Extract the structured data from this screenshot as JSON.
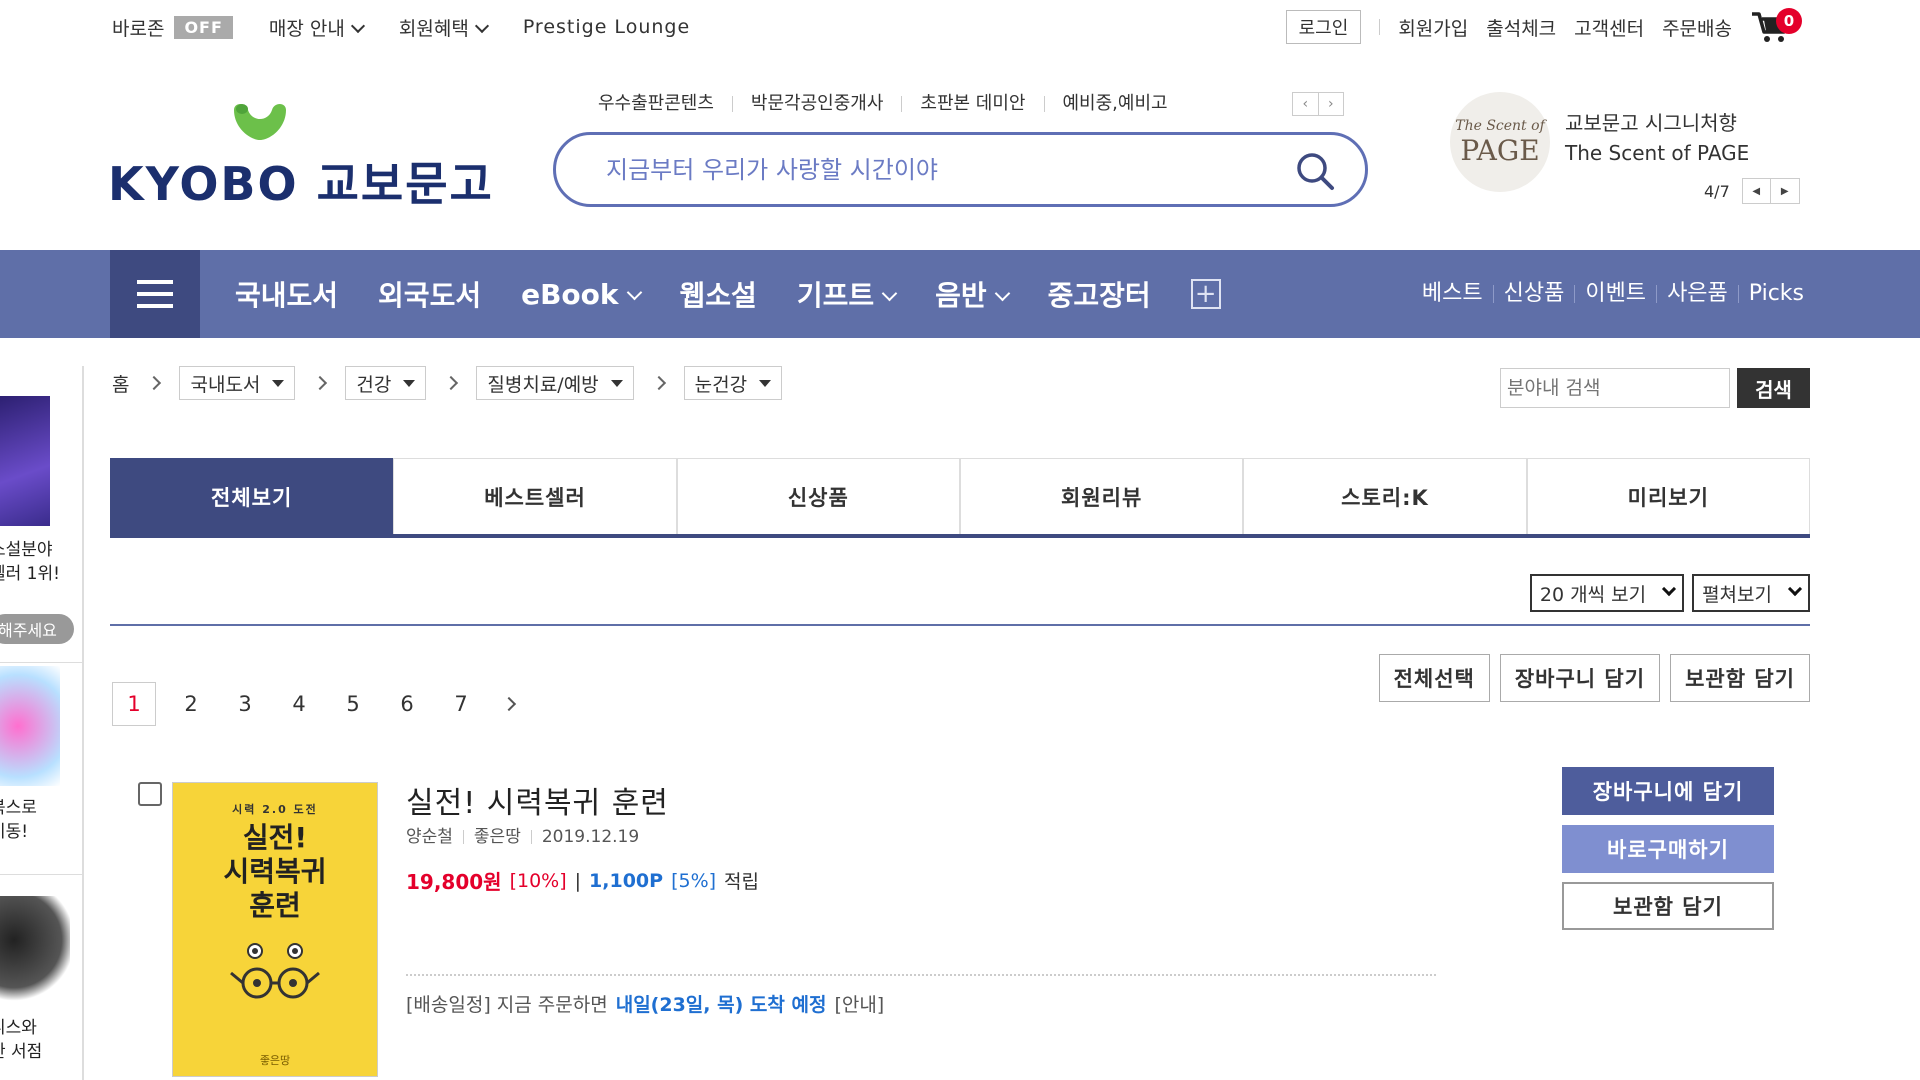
{
  "top_bar": {
    "baro_label": "바로존",
    "baro_status": "OFF",
    "store_info": "매장 안내",
    "member_benefit": "회원혜택",
    "prestige": "Prestige Lounge",
    "login": "로그인",
    "signup": "회원가입",
    "attendance": "출석체크",
    "customer_center": "고객센터",
    "order_delivery": "주문배송",
    "cart_count": "0"
  },
  "logo": {
    "text": "KYOBO 교보문고"
  },
  "hot_links": [
    "우수출판콘텐츠",
    "박문각공인중개사",
    "초판본 데미안",
    "예비중,예비고"
  ],
  "search": {
    "placeholder": "지금부터 우리가 사랑할 시간이야"
  },
  "promo": {
    "circle_line1": "The Scent of",
    "circle_line2": "PAGE",
    "title": "교보문고 시그니처향",
    "subtitle": "The Scent of PAGE",
    "pager": "4/7"
  },
  "nav": {
    "main": [
      {
        "label": "국내도서",
        "dropdown": false
      },
      {
        "label": "외국도서",
        "dropdown": false
      },
      {
        "label": "eBook",
        "dropdown": true
      },
      {
        "label": "웹소설",
        "dropdown": false
      },
      {
        "label": "기프트",
        "dropdown": true
      },
      {
        "label": "음반",
        "dropdown": true
      },
      {
        "label": "중고장터",
        "dropdown": false
      }
    ],
    "sub": [
      "베스트",
      "신상품",
      "이벤트",
      "사은품",
      "Picks"
    ]
  },
  "left_column": {
    "block1_text": [
      "소설분야",
      "셀러 1위!"
    ],
    "block1_pill": "해주세요",
    "block2_text": [
      "북스로",
      "이동!"
    ],
    "block3_text": [
      "니스와",
      "한 서점"
    ]
  },
  "breadcrumb": {
    "home": "홈",
    "levels": [
      "국내도서",
      "건강",
      "질병치료/예방",
      "눈건강"
    ]
  },
  "category_search": {
    "placeholder": "분야내 검색",
    "button": "검색"
  },
  "tabs": [
    {
      "label": "전체보기",
      "active": true
    },
    {
      "label": "베스트셀러",
      "active": false
    },
    {
      "label": "신상품",
      "active": false
    },
    {
      "label": "회원리뷰",
      "active": false
    },
    {
      "label": "스토리:K",
      "active": false
    },
    {
      "label": "미리보기",
      "active": false
    }
  ],
  "view_options": {
    "per_page": "20 개씩 보기",
    "mode": "펼쳐보기"
  },
  "pagination": {
    "current": "1",
    "pages": [
      "2",
      "3",
      "4",
      "5",
      "6",
      "7"
    ]
  },
  "list_actions": {
    "select_all": "전체선택",
    "add_cart": "장바구니 담기",
    "add_keep": "보관함 담기"
  },
  "product": {
    "cover_top": "시력 2.0 도전",
    "cover_title": [
      "실전!",
      "시력복귀",
      "훈련"
    ],
    "cover_publisher": "좋은땅",
    "title": "실전! 시력복귀 훈련",
    "author": "양순철",
    "publisher": "좋은땅",
    "date": "2019.12.19",
    "price": "19,800원",
    "discount": "[10%]",
    "sep": "|",
    "points": "1,100P",
    "point_rate": "[5%]",
    "point_suffix": "적립",
    "delivery_prefix": "[배송일정] 지금 주문하면",
    "delivery_highlight": "내일(23일, 목) 도착 예정",
    "delivery_suffix": "[안내]",
    "btn_cart": "장바구니에 담기",
    "btn_buy": "바로구매하기",
    "btn_keep": "보관함 담기"
  },
  "colors": {
    "brand_navy": "#3e4a80",
    "nav_bg": "#5f6fa8",
    "search_border": "#5f6fb5",
    "price_red": "#e4002b",
    "point_blue": "#1f6fd1",
    "logo_green": "#6cc04a"
  }
}
